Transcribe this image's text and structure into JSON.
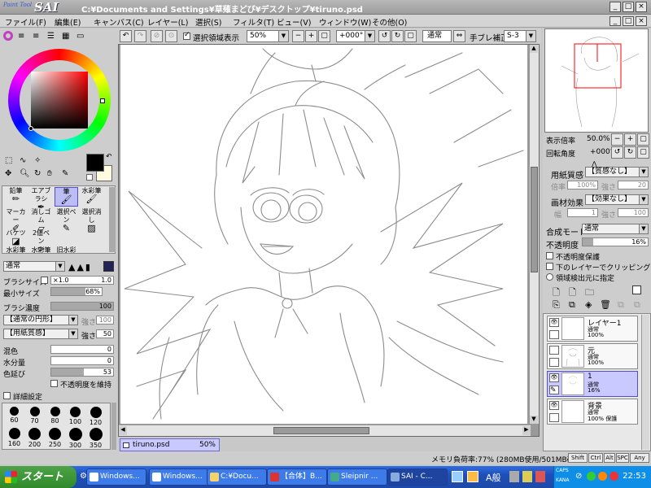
{
  "app": {
    "logo_small": "Paint Tool",
    "logo_big": "SAI",
    "title": "C:¥Documents and Settings¥草薙まどび¥デスクトップ¥tiruno.psd",
    "window_controls": [
      "minimize-icon",
      "maximize-icon",
      "close-icon"
    ]
  },
  "menu": [
    "ファイル(F)",
    "編集(E)",
    "キャンバス(C)",
    "レイヤー(L)",
    "選択(S)",
    "フィルタ(T)",
    "ビュー(V)",
    "ウィンドウ(W)",
    "その他(O)"
  ],
  "toolbar": {
    "selection_label": "選択領域表示",
    "zoom": "50%",
    "rotation": "+000°",
    "blend": "通常",
    "stabilizer_label": "手ブレ補正",
    "stabilizer": "S-3"
  },
  "color": {
    "current": "#000000",
    "background": "#fffbe0",
    "wheel_marker": "#ff2020"
  },
  "tools": [
    {
      "label": "鉛筆",
      "icon": "pencil-icon"
    },
    {
      "label": "エアブラシ",
      "icon": "airbrush-icon"
    },
    {
      "label": "筆",
      "icon": "brush-icon"
    },
    {
      "label": "水彩筆",
      "icon": "watercolor-icon"
    },
    {
      "label": "マーカー",
      "icon": "marker-icon"
    },
    {
      "label": "消しゴム",
      "icon": "eraser-icon"
    },
    {
      "label": "選択ペン",
      "icon": "select-pen-icon"
    },
    {
      "label": "選択消し",
      "icon": "select-erase-icon"
    },
    {
      "label": "バケツ",
      "icon": "bucket-icon"
    },
    {
      "label": "2値ペン",
      "icon": "binary-pen-icon"
    },
    {
      "label": "水彩筆",
      "icon": "watercolor2-icon"
    },
    {
      "label": "水彩筆",
      "icon": "watercolor3-icon"
    },
    {
      "label": "旧水彩",
      "icon": "old-watercolor-icon"
    }
  ],
  "brush": {
    "mode": "通常",
    "size_label": "ブラシサイズ",
    "size_mult": "×1.0",
    "size_value": "1.0",
    "min_size_label": "最小サイズ",
    "min_size_value": "68%",
    "min_size_fraction": 0.68,
    "density_label": "ブラシ濃度",
    "density_value": "100",
    "shape": "【通常の円形】",
    "shape_strength_label": "強さ",
    "shape_strength": "100",
    "texture": "【用紙質感】",
    "texture_strength_label": "強さ",
    "texture_strength": "50",
    "blend_label": "混色",
    "blend_value": "0",
    "water_label": "水分量",
    "water_value": "0",
    "stretch_label": "色延び",
    "stretch_value": "53",
    "stretch_fraction": 0.53,
    "keep_opacity_label": "不透明度を維持",
    "detail_label": "詳細設定",
    "sizes": [
      "60",
      "70",
      "80",
      "100",
      "120",
      "160",
      "200",
      "250",
      "300",
      "350"
    ]
  },
  "document": {
    "name": "tiruno.psd",
    "zoom": "50%"
  },
  "status": {
    "memory": "メモリ負荷率:77% (280MB使用/501MB確保)",
    "keys": [
      "Shift",
      "Ctrl",
      "Alt",
      "SPC",
      "Any"
    ]
  },
  "right": {
    "zoom_label": "表示倍率",
    "zoom_value": "50.0%",
    "angle_label": "回転角度",
    "angle_value": "+000°",
    "paper_label": "用紙質感",
    "paper_value": "【質感なし】",
    "paper_strength_label": "倍率",
    "paper_strength": "100%",
    "paper_strength2_label": "強さ",
    "paper_strength2": "20",
    "effect_label": "画材効果",
    "effect_value": "【効果なし】",
    "effect_width_label": "幅",
    "effect_width": "1",
    "effect_strength_label": "強さ",
    "effect_strength": "100",
    "blend_mode_label": "合成モード",
    "blend_mode_value": "通常",
    "opacity_label": "不透明度",
    "opacity_value": "16%",
    "opacity_fraction": 0.16,
    "protect_label": "不透明度保護",
    "clip_label": "下のレイヤーでクリッピング",
    "source_label": "領域検出元に指定"
  },
  "layers": [
    {
      "name": "レイヤー1",
      "mode": "通常",
      "opacity": "100%",
      "extra": ""
    },
    {
      "name": "元",
      "mode": "通常",
      "opacity": "100%",
      "extra": ""
    },
    {
      "name": "1",
      "mode": "通常",
      "opacity": "16%",
      "extra": ""
    },
    {
      "name": "背景",
      "mode": "通常",
      "opacity": "100%",
      "extra": "保護"
    }
  ],
  "taskbar": {
    "start": "スタート",
    "tasks": [
      "Windows...",
      "Windows...",
      "C:¥Docu...",
      "【合体】B...",
      "Sleipnir ...",
      "SAI - C..."
    ],
    "ime": "A般",
    "caps": "CAPS",
    "kana": "KANA",
    "clock": "22:53"
  }
}
